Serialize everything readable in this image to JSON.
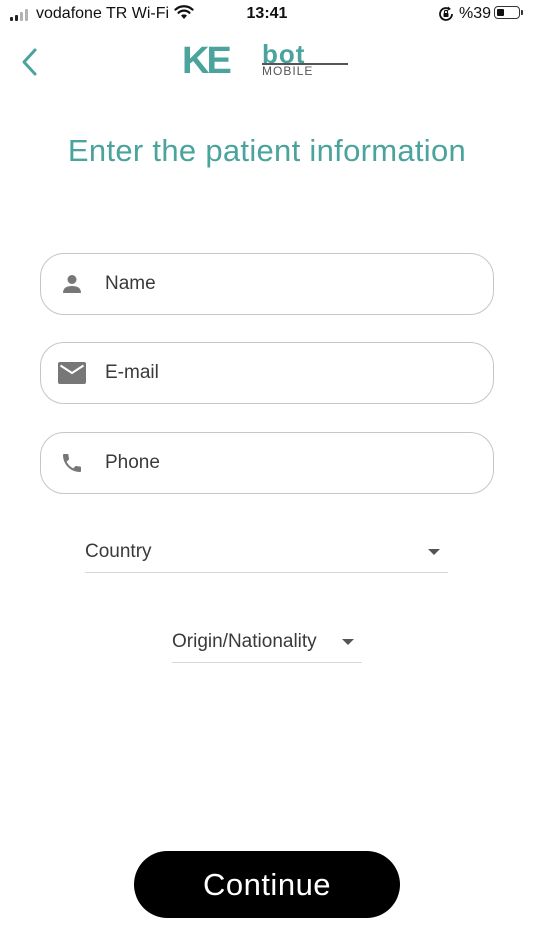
{
  "status_bar": {
    "carrier": "vodafone TR Wi-Fi",
    "time": "13:41",
    "battery": "%39",
    "battery_level": 0.39
  },
  "header": {
    "logo_ke": "KE",
    "logo_bot": "bot",
    "logo_mobile": "MOBILE",
    "back_icon": "chevron-left-icon"
  },
  "page": {
    "title": "Enter the patient information"
  },
  "form": {
    "name": {
      "placeholder": "Name",
      "value": "",
      "icon": "person-icon"
    },
    "email": {
      "placeholder": "E-mail",
      "value": "",
      "icon": "mail-icon"
    },
    "phone": {
      "placeholder": "Phone",
      "value": "",
      "icon": "phone-icon"
    },
    "country": {
      "selected": "Country"
    },
    "origin": {
      "selected": "Origin/Nationality"
    }
  },
  "actions": {
    "continue_label": "Continue"
  },
  "colors": {
    "accent": "#4aa39d",
    "button_bg": "#000000",
    "button_text": "#ffffff",
    "field_border": "#c6c6c6",
    "icon": "#777777"
  }
}
